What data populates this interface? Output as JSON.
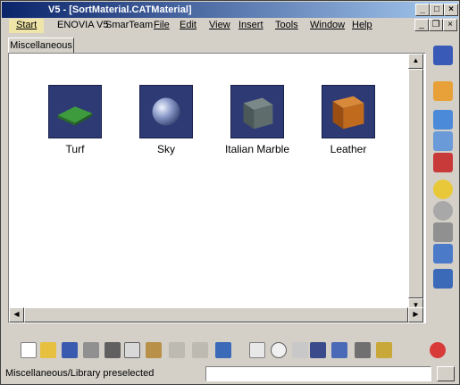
{
  "window": {
    "title": "V5 - [SortMaterial.CATMaterial]"
  },
  "menubar": {
    "items": [
      "Start",
      "ENOVIA V5",
      "SmarTeam",
      "File",
      "Edit",
      "View",
      "Insert",
      "Tools",
      "Window",
      "Help"
    ]
  },
  "tabs": [
    {
      "label": "Miscellaneous",
      "active": true
    }
  ],
  "materials": [
    {
      "label": "Turf",
      "icon": "turf-material-icon",
      "color": "#3a8a3a"
    },
    {
      "label": "Sky",
      "icon": "sky-material-icon",
      "color": "#8a9ac8"
    },
    {
      "label": "Italian Marble",
      "icon": "marble-material-icon",
      "color": "#5a6a6a"
    },
    {
      "label": "Leather",
      "icon": "leather-material-icon",
      "color": "#c06a1e"
    }
  ],
  "right_toolbar": {
    "icons": [
      "compass-icon",
      "select-icon",
      "new-family-icon",
      "new-material-icon",
      "apply-material-icon",
      "light-icon",
      "material-properties-icon",
      "environment-icon",
      "catalog-icon",
      "sort-icon"
    ]
  },
  "bottom_toolbar": {
    "icons": [
      "new-icon",
      "open-icon",
      "save-icon",
      "print-icon",
      "cut-icon",
      "copy-icon",
      "paste-icon",
      "undo-icon",
      "redo-icon",
      "whats-this-icon",
      "formula-icon",
      "comment-icon",
      "measure-icon",
      "table-icon",
      "tree-icon",
      "lock-icon",
      "macro-icon",
      "3ds-logo-icon"
    ]
  },
  "statusbar": {
    "text": "Miscellaneous/Library preselected",
    "input_value": ""
  }
}
